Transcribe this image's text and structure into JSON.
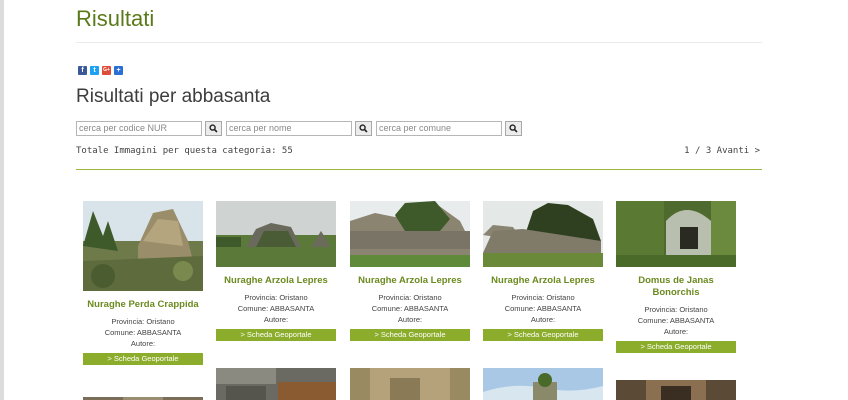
{
  "page": {
    "title": "Risultati"
  },
  "social": [
    "f",
    "t",
    "G+",
    "+"
  ],
  "results_heading": "Risultati per abbasanta",
  "search": {
    "code_placeholder": "cerca per codice NUR",
    "name_placeholder": "cerca per nome",
    "comune_placeholder": "cerca per comune"
  },
  "summary": {
    "total_label": "Totale Immagini per questa categoria: 55",
    "pager": "1 / 3 Avanti >"
  },
  "cards": [
    {
      "name": "Nuraghe Perda Crappida",
      "provincia": "Provincia: Oristano",
      "comune": "Comune: ABBASANTA",
      "autore": "Autore:",
      "link": "> Scheda Geoportale"
    },
    {
      "name": "Nuraghe Arzola Lepres",
      "provincia": "Provincia: Oristano",
      "comune": "Comune: ABBASANTA",
      "autore": "Autore:",
      "link": "> Scheda Geoportale"
    },
    {
      "name": "Nuraghe Arzola Lepres",
      "provincia": "Provincia: Oristano",
      "comune": "Comune: ABBASANTA",
      "autore": "Autore:",
      "link": "> Scheda Geoportale"
    },
    {
      "name": "Nuraghe Arzola Lepres",
      "provincia": "Provincia: Oristano",
      "comune": "Comune: ABBASANTA",
      "autore": "Autore:",
      "link": "> Scheda Geoportale"
    },
    {
      "name": "Domus de Janas Bonorchis",
      "provincia": "Provincia: Oristano",
      "comune": "Comune: ABBASANTA",
      "autore": "Autore:",
      "link": "> Scheda Geoportale"
    }
  ],
  "colors": {
    "accent": "#8bad2b",
    "title_green": "#5a7a1a",
    "link_green": "#6b8a1f"
  }
}
